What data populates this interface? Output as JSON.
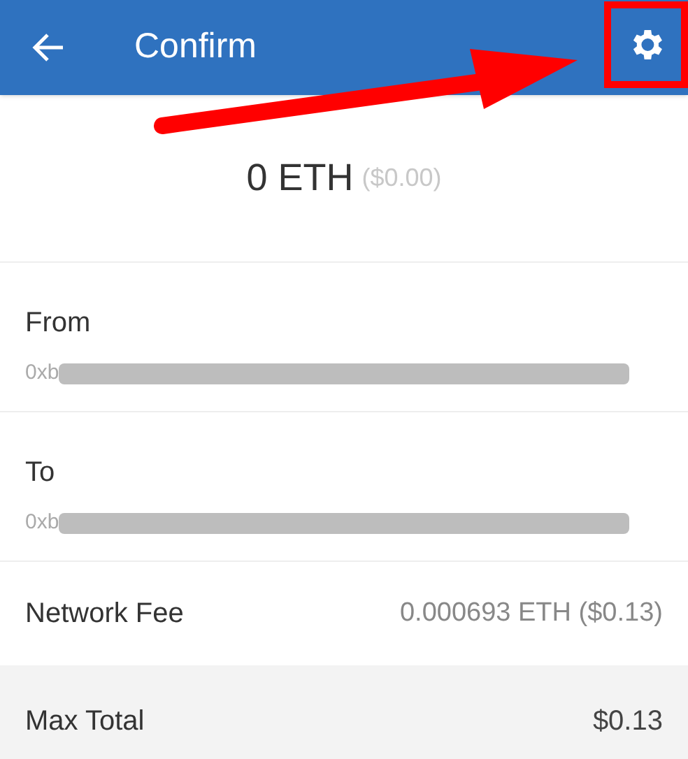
{
  "header": {
    "title": "Confirm"
  },
  "amount": {
    "value": "0 ETH",
    "fiat": "($0.00)"
  },
  "accounts": [
    {
      "label": "From",
      "address": "0xb"
    },
    {
      "label": "To",
      "address": "0xb"
    }
  ],
  "fee": {
    "label": "Network Fee",
    "value": "0.000693 ETH ($0.13)"
  },
  "total": {
    "label": "Max Total",
    "value": "$0.13"
  }
}
